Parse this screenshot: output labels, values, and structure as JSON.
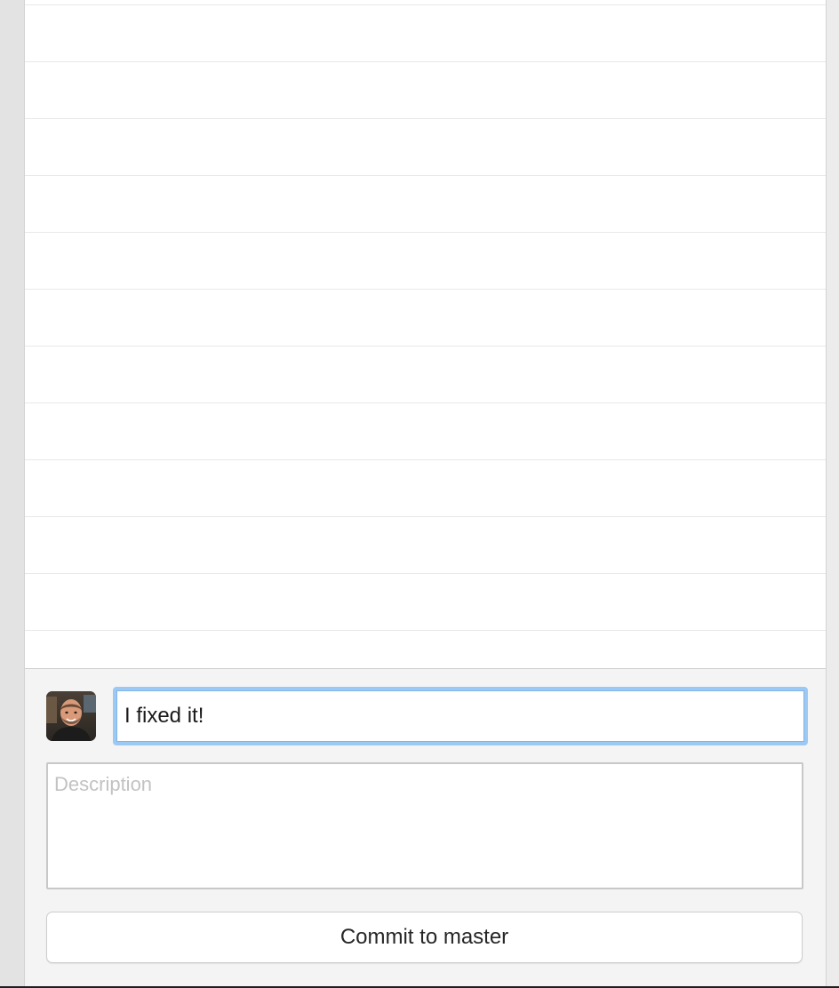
{
  "file_list": {
    "row_count": 12
  },
  "commit": {
    "author_avatar": "user-avatar",
    "summary_value": "I fixed it!",
    "description_placeholder": "Description",
    "description_value": "",
    "commit_button_label": "Commit to master"
  },
  "colors": {
    "focus_ring": "#9cc8f4",
    "panel_background": "#f4f4f4",
    "list_background": "#ffffff",
    "row_divider": "#e8e8e8",
    "placeholder": "#c2c2c2"
  }
}
